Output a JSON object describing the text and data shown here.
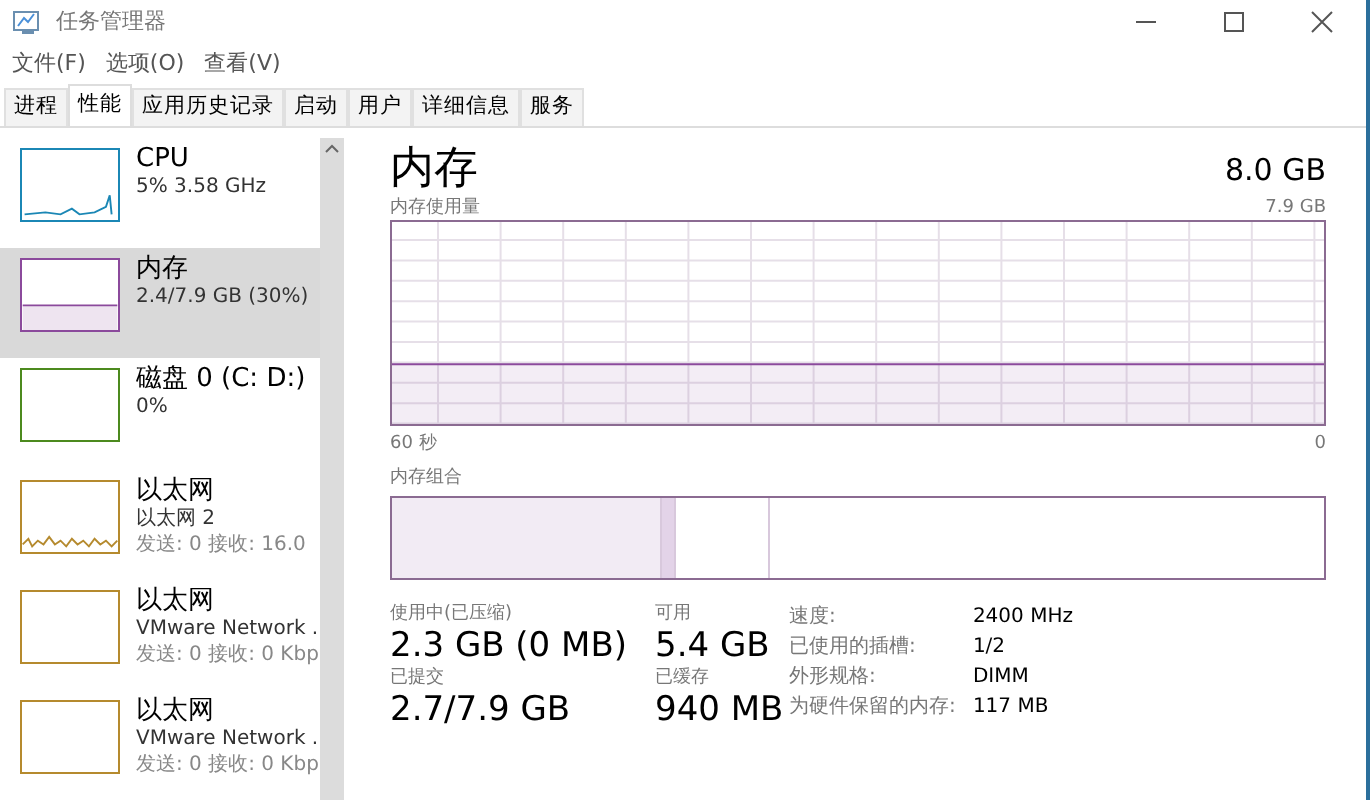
{
  "window": {
    "title": "任务管理器"
  },
  "menu": [
    "文件(F)",
    "选项(O)",
    "查看(V)"
  ],
  "tabs": [
    {
      "label": "进程",
      "selected": false
    },
    {
      "label": "性能",
      "selected": true
    },
    {
      "label": "应用历史记录",
      "selected": false
    },
    {
      "label": "启动",
      "selected": false
    },
    {
      "label": "用户",
      "selected": false
    },
    {
      "label": "详细信息",
      "selected": false
    },
    {
      "label": "服务",
      "selected": false
    }
  ],
  "sidebar": {
    "items": [
      {
        "kind": "cpu",
        "title": "CPU",
        "lines": [
          "5% 3.58 GHz"
        ],
        "color": "#1b87b5",
        "selected": false
      },
      {
        "kind": "memory",
        "title": "内存",
        "lines": [
          "2.4/7.9 GB (30%)"
        ],
        "color": "#8b4a9c",
        "selected": true
      },
      {
        "kind": "disk",
        "title": "磁盘 0 (C: D:)",
        "lines": [
          "0%"
        ],
        "color": "#4c8a1e",
        "selected": false
      },
      {
        "kind": "network",
        "title": "以太网",
        "lines": [
          "以太网 2",
          "发送: 0 接收: 16.0"
        ],
        "color": "#b58a2e",
        "selected": false
      },
      {
        "kind": "idle",
        "title": "以太网",
        "lines": [
          "VMware Network .",
          "发送: 0 接收: 0 Kbp"
        ],
        "color": "#b58a2e",
        "selected": false
      },
      {
        "kind": "idle",
        "title": "以太网",
        "lines": [
          "VMware Network .",
          "发送: 0 接收: 0 Kbp"
        ],
        "color": "#b58a2e",
        "selected": false
      }
    ]
  },
  "main": {
    "title": "内存",
    "total": "8.0 GB",
    "usage_graph": {
      "label": "内存使用量",
      "max": "7.9 GB",
      "x_start": "60 秒",
      "x_end": "0"
    },
    "composition": {
      "label": "内存组合"
    },
    "stats": [
      {
        "label": "使用中(已压缩)",
        "value": "2.3 GB (0 MB)"
      },
      {
        "label": "可用",
        "value": "5.4 GB"
      },
      {
        "label": "已提交",
        "value": "2.7/7.9 GB"
      },
      {
        "label": "已缓存",
        "value": "940 MB"
      }
    ],
    "details": [
      {
        "label": "速度:",
        "value": "2400 MHz"
      },
      {
        "label": "已使用的插槽:",
        "value": "1/2"
      },
      {
        "label": "外形规格:",
        "value": "DIMM"
      },
      {
        "label": "为硬件保留的内存:",
        "value": "117 MB"
      }
    ]
  }
}
